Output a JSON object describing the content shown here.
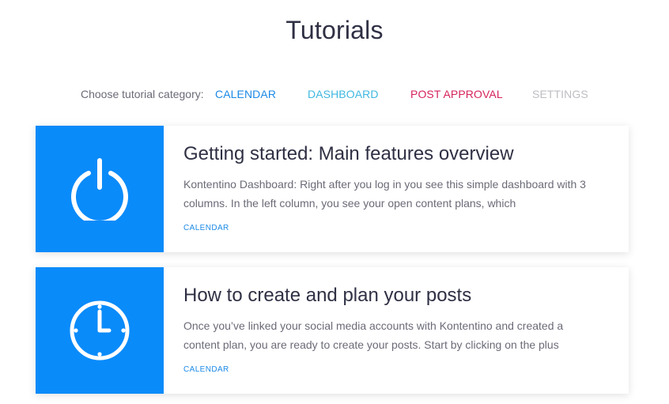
{
  "page": {
    "title": "Tutorials"
  },
  "categories": {
    "label": "Choose tutorial category:",
    "items": [
      {
        "label": "CALENDAR",
        "color": "#1c8ae6"
      },
      {
        "label": "DASHBOARD",
        "color": "#3fb8e0"
      },
      {
        "label": "POST APPROVAL",
        "color": "#d6245c"
      },
      {
        "label": "SETTINGS",
        "color": "#bdbdc3"
      }
    ]
  },
  "tutorials": [
    {
      "icon": "power-icon",
      "icon_bg": "#0a8bfa",
      "title": "Getting started: Main features overview",
      "excerpt": "Kontentino Dashboard: Right after you log in you see this simple dashboard with 3 columns. In the left column, you see your open content plans, which",
      "tag": "CALENDAR"
    },
    {
      "icon": "clock-icon",
      "icon_bg": "#0a8bfa",
      "title": "How to create and plan your posts",
      "excerpt": "Once you’ve linked your social media accounts with Kontentino and created a content plan, you are ready to create your posts. Start by clicking on the plus",
      "tag": "CALENDAR"
    }
  ]
}
